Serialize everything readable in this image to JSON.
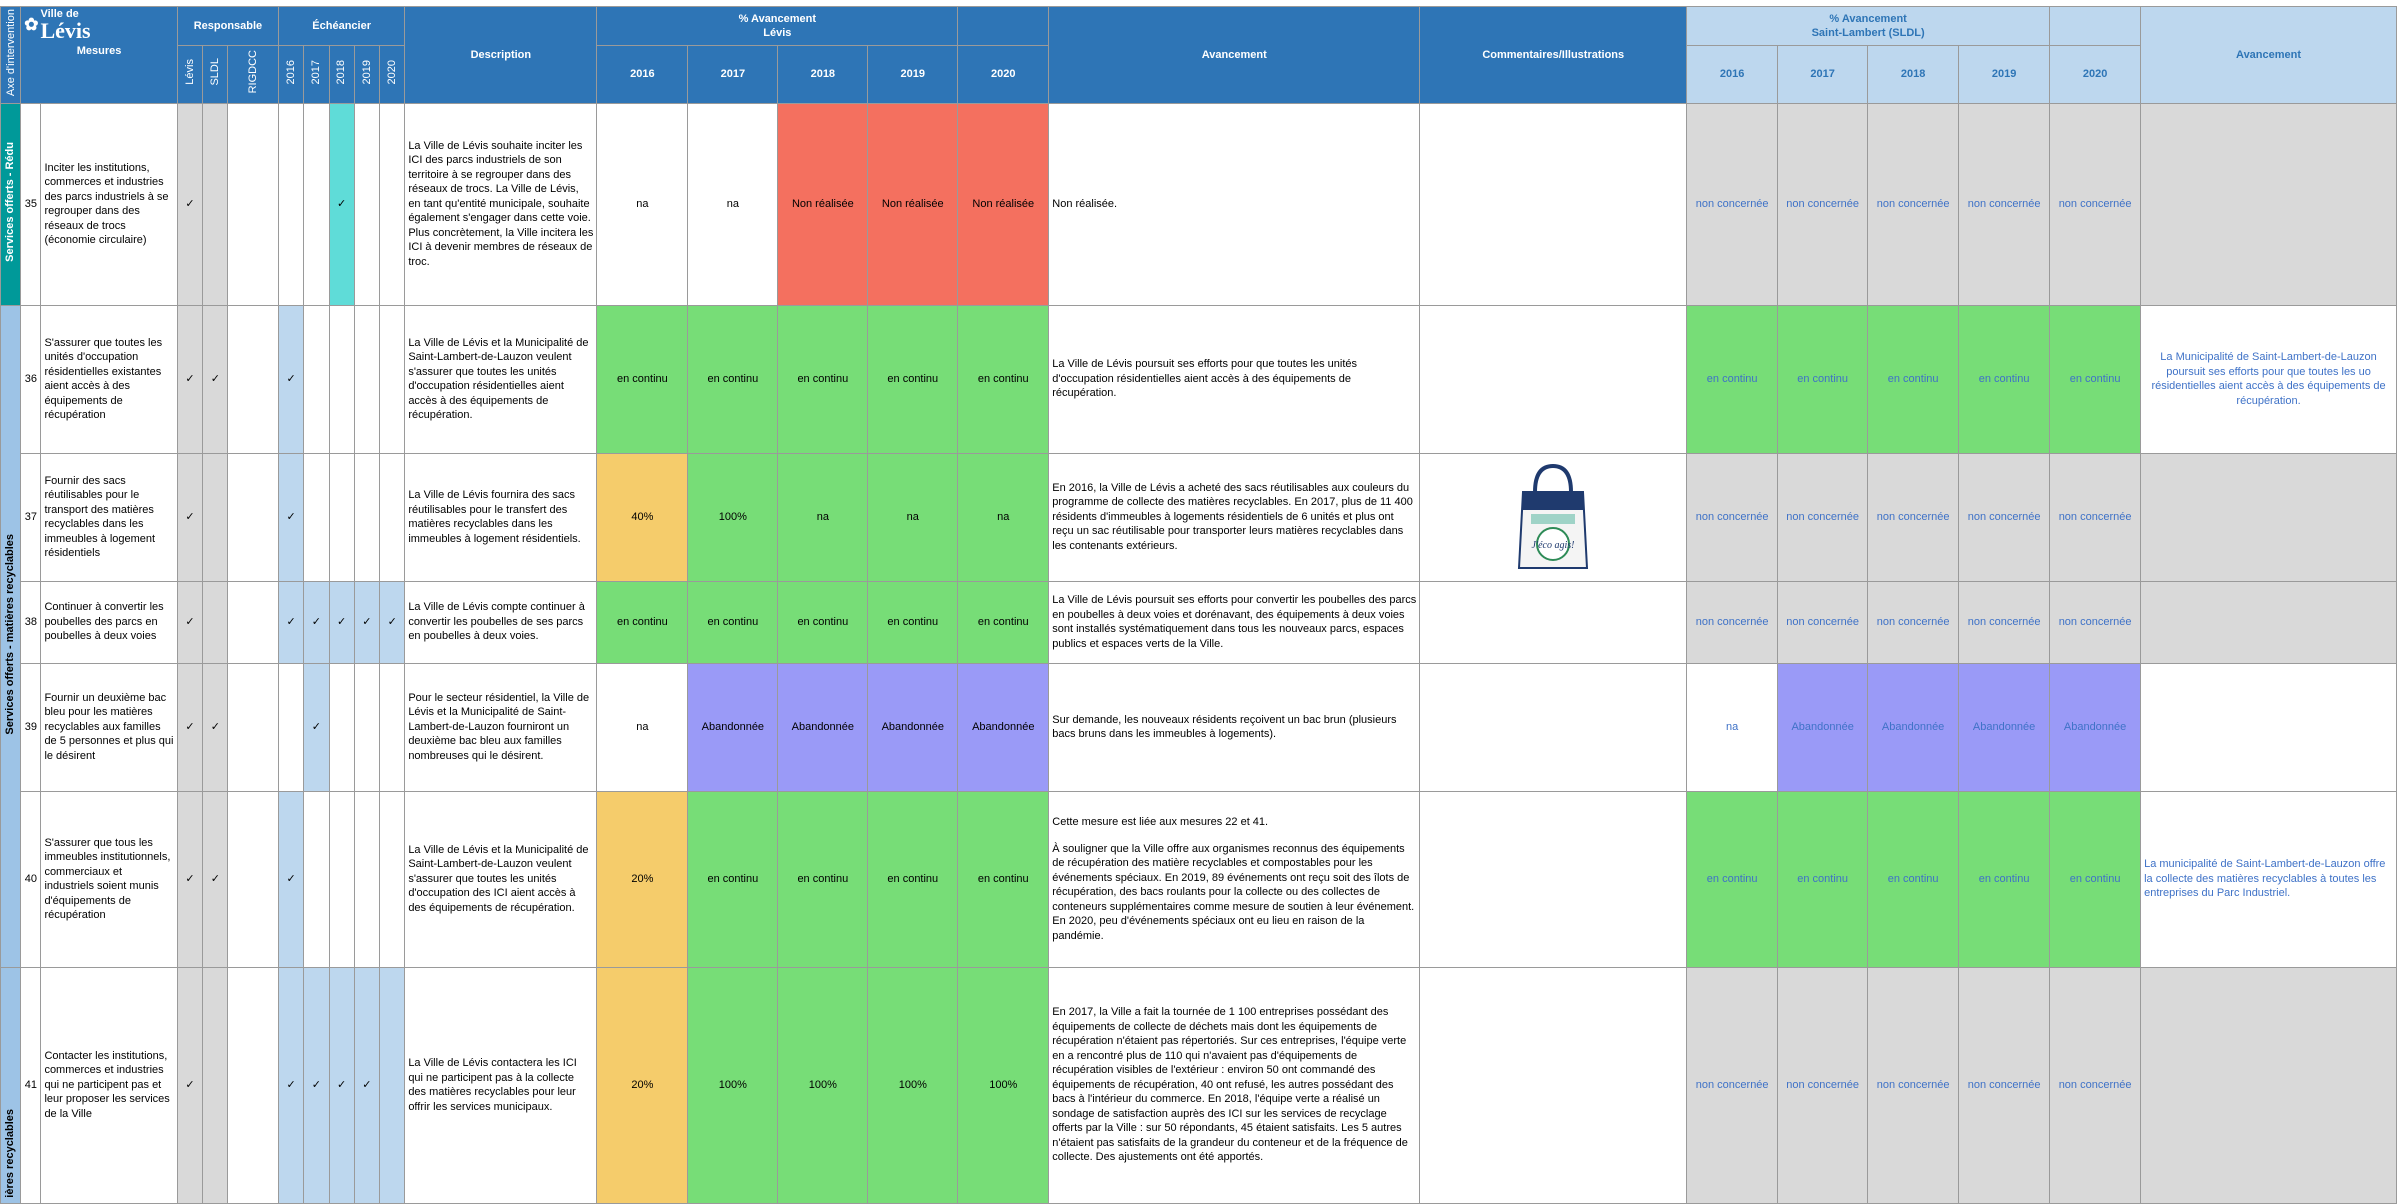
{
  "header": {
    "axis_label": "Axe d'intervention",
    "logo_line1": "Ville de",
    "logo_line2": "Lévis",
    "mesures": "Mesures",
    "responsable": "Responsable",
    "responsable_cols": [
      "Lévis",
      "SLDL",
      "RIGDCC"
    ],
    "echeancier": "Échéancier",
    "years": [
      "2016",
      "2017",
      "2018",
      "2019",
      "2020"
    ],
    "description": "Description",
    "avancement_pct_line1": "% Avancement",
    "avancement_pct_line2": "Lévis",
    "avancement": "Avancement",
    "commentaires": "Commentaires/Illustrations",
    "sldl_pct_line1": "% Avancement",
    "sldl_pct_line2": "Saint-Lambert (SLDL)",
    "sldl_avancement": "Avancement"
  },
  "axes": [
    {
      "label": "Services offerts - Rédu",
      "color": "#009999"
    },
    {
      "label": "Services offerts - matières recyclables",
      "color": "#2e75b6"
    },
    {
      "label": "ières recyclables",
      "color": "#2e75b6"
    }
  ],
  "check": "✓",
  "rows": [
    {
      "num": "35",
      "mesure": "Inciter les institutions, commerces et industries des parcs industriels à se regrouper dans des réseaux de trocs (économie circulaire)",
      "description": "La Ville de Lévis souhaite inciter les ICI des parcs industriels de son territoire à se regrouper dans des réseaux de trocs. La Ville de Lévis, en tant qu'entité municipale, souhaite également s'engager dans cette voie. Plus concrètement, la Ville incitera les ICI à devenir membres de réseaux de troc.",
      "levis_status": [
        "na",
        "na",
        "Non réalisée",
        "Non réalisée",
        "Non réalisée"
      ],
      "avancement": "Non réalisée.",
      "sldl_status": [
        "non concernée",
        "non concernée",
        "non concernée",
        "non concernée",
        "non concernée"
      ],
      "sldl_avancement": ""
    },
    {
      "num": "36",
      "mesure": "S'assurer que toutes les unités d'occupation résidentielles existantes aient accès à des équipements de récupération",
      "description": "La Ville de Lévis et la Municipalité de Saint-Lambert-de-Lauzon veulent s'assurer que toutes les unités d'occupation résidentielles aient accès à des équipements de récupération.",
      "levis_status": [
        "en continu",
        "en continu",
        "en continu",
        "en continu",
        "en continu"
      ],
      "avancement": "La Ville de Lévis poursuit ses efforts pour que toutes les unités d'occupation résidentielles aient accès à des équipements de récupération.",
      "sldl_status": [
        "en continu",
        "en continu",
        "en continu",
        "en continu",
        "en continu"
      ],
      "sldl_avancement": "La Municipalité de Saint-Lambert-de-Lauzon poursuit ses efforts pour que toutes les uo résidentielles aient accès à des équipements de récupération."
    },
    {
      "num": "37",
      "mesure": "Fournir des sacs réutilisables pour le transport des matières recyclables dans les immeubles à logement résidentiels",
      "description": "La Ville de Lévis fournira des sacs réutilisables pour le transfert des matières recyclables dans les immeubles à logement résidentiels.",
      "levis_status": [
        "40%",
        "100%",
        "na",
        "na",
        "na"
      ],
      "avancement": "En 2016, la Ville de Lévis a acheté des sacs réutilisables aux couleurs du programme de collecte des matières recyclables. En 2017, plus de 11 400 résidents d'immeubles à logements résidentiels de 6 unités et plus ont reçu un sac réutilisable pour transporter leurs matières recyclables dans les contenants extérieurs.",
      "bag_text": "J'éco agis!",
      "sldl_status": [
        "non concernée",
        "non concernée",
        "non concernée",
        "non concernée",
        "non concernée"
      ],
      "sldl_avancement": ""
    },
    {
      "num": "38",
      "mesure": "Continuer à convertir les poubelles des parcs en poubelles à deux voies",
      "description": "La Ville de Lévis compte continuer à convertir les poubelles de ses parcs en poubelles à deux voies.",
      "levis_status": [
        "en continu",
        "en continu",
        "en continu",
        "en continu",
        "en continu"
      ],
      "avancement": "La Ville de Lévis poursuit ses efforts pour convertir les poubelles des parcs en poubelles à deux voies et dorénavant, des équipements à deux voies sont installés systématiquement dans tous les nouveaux parcs, espaces publics et espaces verts de la Ville.",
      "sldl_status": [
        "non concernée",
        "non concernée",
        "non concernée",
        "non concernée",
        "non concernée"
      ],
      "sldl_avancement": ""
    },
    {
      "num": "39",
      "mesure": "Fournir un deuxième bac bleu pour les matières recyclables aux familles de 5 personnes et plus qui le désirent",
      "description": "Pour le secteur résidentiel, la Ville de Lévis et la Municipalité de Saint-Lambert-de-Lauzon fourniront un deuxième bac bleu aux familles nombreuses qui le désirent.",
      "levis_status": [
        "na",
        "Abandonnée",
        "Abandonnée",
        "Abandonnée",
        "Abandonnée"
      ],
      "avancement": "Sur demande, les nouveaux résidents reçoivent un bac brun (plusieurs bacs bruns dans les immeubles à logements).",
      "sldl_status": [
        "na",
        "Abandonnée",
        "Abandonnée",
        "Abandonnée",
        "Abandonnée"
      ],
      "sldl_avancement": ""
    },
    {
      "num": "40",
      "mesure": "S'assurer que tous les immeubles institutionnels, commerciaux et industriels soient munis d'équipements de récupération",
      "description": "La Ville de Lévis et la Municipalité de Saint-Lambert-de-Lauzon veulent s'assurer que toutes les unités d'occupation des ICI aient accès à des équipements de récupération.",
      "levis_status": [
        "20%",
        "en continu",
        "en continu",
        "en continu",
        "en continu"
      ],
      "avancement_p1": "Cette mesure est liée aux mesures 22 et 41.",
      "avancement": "À souligner que la Ville offre aux organismes reconnus des équipements de récupération des matière recyclables et compostables pour les événements spéciaux. En 2019,  89 événements ont reçu soit des îlots de récupération, des bacs roulants pour la collecte ou des collectes de conteneurs supplémentaires comme mesure de soutien à leur événement. En 2020, peu d'événements spéciaux ont eu lieu en raison de la pandémie.",
      "sldl_status": [
        "en continu",
        "en continu",
        "en continu",
        "en continu",
        "en continu"
      ],
      "sldl_avancement": "La municipalité de Saint-Lambert-de-Lauzon offre la collecte des matières recyclables à toutes les entreprises du Parc Industriel."
    },
    {
      "num": "41",
      "mesure": "Contacter les institutions, commerces et industries qui ne participent pas et leur proposer les services de la Ville",
      "description": "La Ville de Lévis contactera les ICI qui ne participent pas à la collecte des matières recyclables pour leur offrir les services municipaux.",
      "levis_status": [
        "20%",
        "100%",
        "100%",
        "100%",
        "100%"
      ],
      "avancement": "En 2017, la Ville a fait la tournée de 1 100 entreprises possédant des équipements de collecte de déchets mais dont les équipements de récupération n'étaient pas répertoriés. Sur ces entreprises, l'équipe verte en a rencontré plus de 110 qui n'avaient pas d'équipements de récupération visibles de l'extérieur : environ 50 ont commandé des équipements de récupération, 40 ont refusé, les autres possédant des bacs à l'intérieur du commerce. En 2018, l'équipe verte a réalisé un sondage de satisfaction auprès des ICI sur les services de recyclage offerts par la Ville : sur 50 répondants, 45 étaient satisfaits. Les 5 autres n'étaient pas satisfaits de la grandeur du conteneur et de la fréquence de collecte. Des ajustements ont été apportés.",
      "sldl_status": [
        "non concernée",
        "non concernée",
        "non concernée",
        "non concernée",
        "non concernée"
      ],
      "sldl_avancement": ""
    }
  ],
  "colors": {
    "header_blue": "#2e75b6",
    "header_light_blue": "#bdd7ee",
    "teal_axis": "#009999",
    "green": "#77dd77",
    "red": "#f4705f",
    "orange": "#f5cc6b",
    "purple": "#9a9af7",
    "gray": "#d9d9d9",
    "sldl_text": "#3f72c7"
  }
}
